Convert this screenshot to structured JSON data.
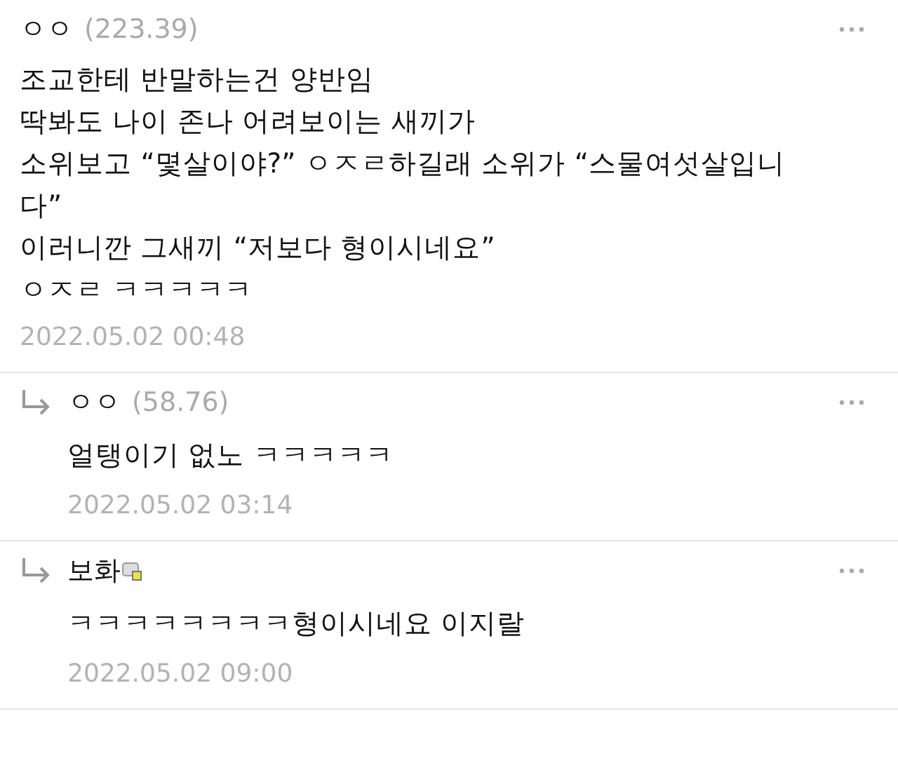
{
  "comments": [
    {
      "kind": "comment",
      "author": "ㅇㅇ",
      "score": "(223.39)",
      "badge": false,
      "body": [
        "조교한테 반말하는건 양반임",
        "딱봐도 나이 존나 어려보이는 새끼가",
        "소위보고 “몇살이야?” ㅇㅈㄹ하길래 소위가 “스물여섯살입니",
        "다”",
        "이러니깐 그새끼 “저보다 형이시네요”",
        "ㅇㅈㄹ ㅋㅋㅋㅋㅋ"
      ],
      "date": "2022.05.02 00:48"
    },
    {
      "kind": "reply",
      "author": "ㅇㅇ",
      "score": "(58.76)",
      "badge": false,
      "body": [
        "얼탱이기 없노 ㅋㅋㅋㅋㅋ"
      ],
      "date": "2022.05.02 03:14"
    },
    {
      "kind": "reply",
      "author": "보화",
      "badge": true,
      "body": [
        "ㅋㅋㅋㅋㅋㅋㅋㅋ형이시네요 이지랄"
      ],
      "date": "2022.05.02 09:00"
    }
  ]
}
